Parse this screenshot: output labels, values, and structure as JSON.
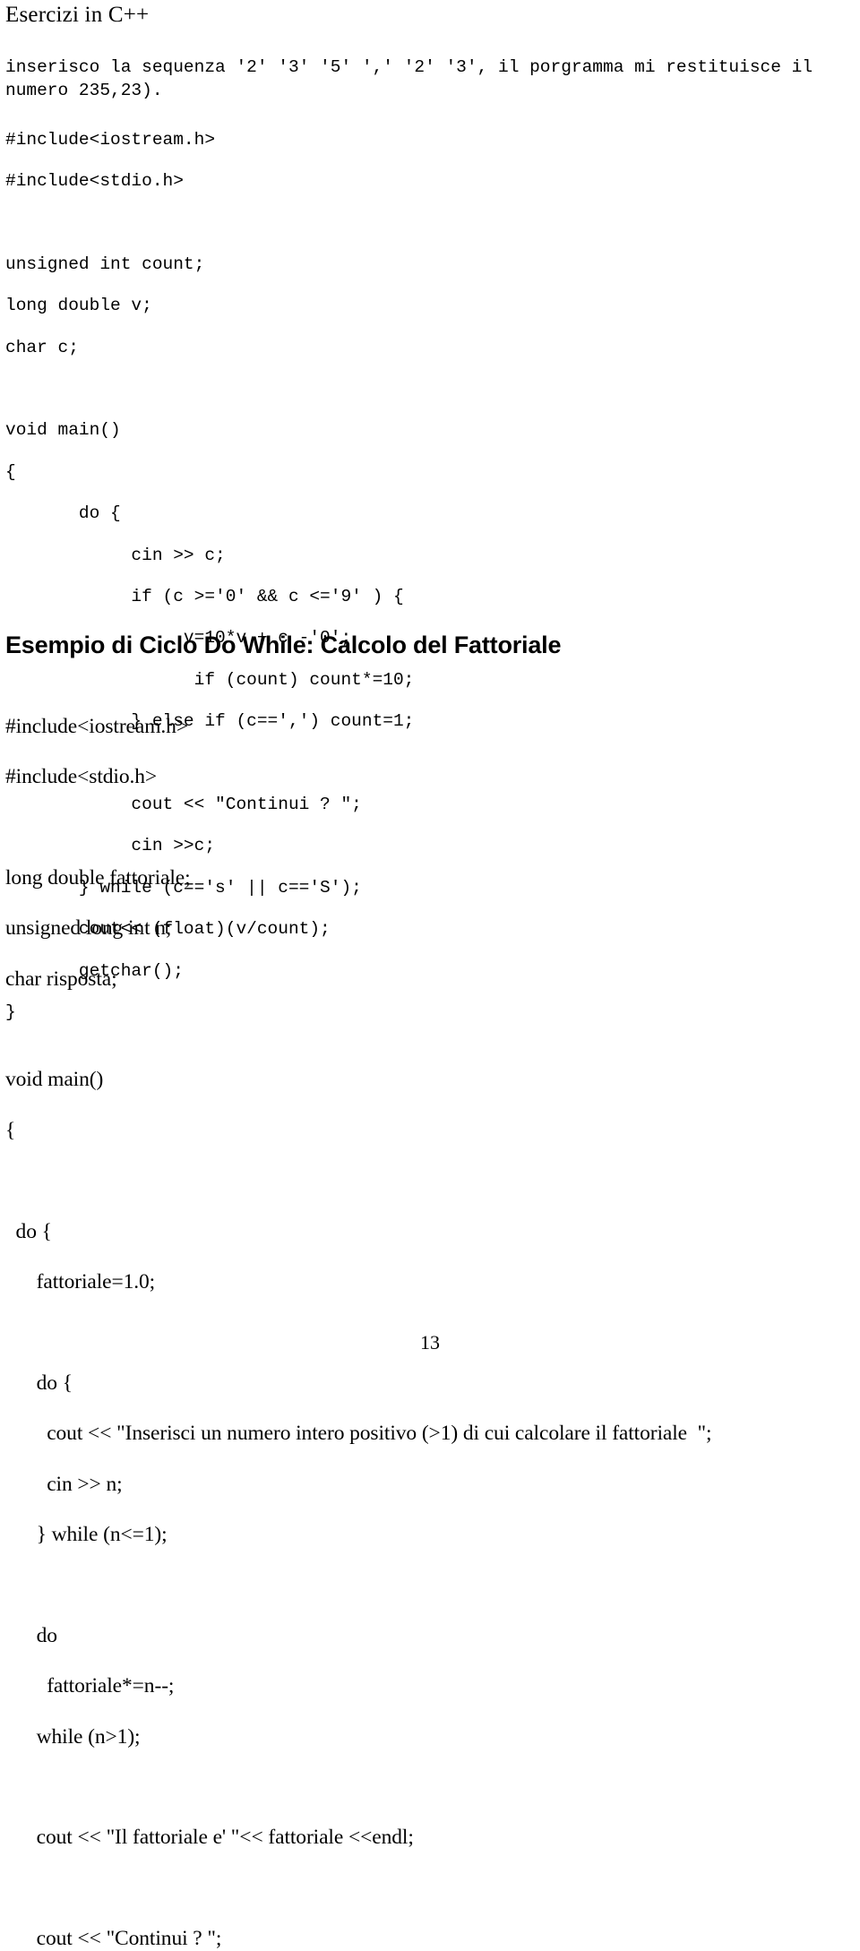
{
  "document": {
    "header_title": "Esercizi in C++",
    "page_number": "13",
    "background_color": "#ffffff",
    "text_color": "#000000"
  },
  "intro_paragraph": {
    "text": "inserisco la sequenza '2' '3' '5' ',' '2' '3', il porgramma mi restituisce il\nnumero 235,23)."
  },
  "code_block_1": {
    "font": "monospace",
    "lines": [
      "#include<iostream.h>",
      "#include<stdio.h>",
      "",
      "unsigned int count;",
      "long double v;",
      "char c;",
      "",
      "void main()",
      "{",
      "       do {",
      "            cin >> c;",
      "            if (c >='0' && c <='9' ) {",
      "                 v=10*v + c -'0';",
      "                  if (count) count*=10;",
      "            } else if (c==',') count=1;",
      "",
      "            cout << \"Continui ? \";",
      "            cin >>c;",
      "       } while (c=='s' || c=='S');",
      "       cout<< (float)(v/count);",
      "       getchar();",
      "}"
    ]
  },
  "section_heading": {
    "text": "Esempio di Ciclo Do While: Calcolo del Fattoriale"
  },
  "code_block_2": {
    "font": "serif",
    "lines": [
      "#include<iostream.h>",
      "#include<stdio.h>",
      "",
      "long double fattoriale;",
      "unsigned long int n;",
      "char risposta;",
      "",
      "void main()",
      "{",
      "",
      "  do {",
      "      fattoriale=1.0;",
      "",
      "      do {",
      "        cout << \"Inserisci un numero intero positivo (>1) di cui calcolare il fattoriale  \";",
      "        cin >> n;",
      "      } while (n<=1);",
      "",
      "      do",
      "        fattoriale*=n--;",
      "      while (n>1);",
      "",
      "      cout << \"Il fattoriale e' \"<< fattoriale <<endl;",
      "",
      "      cout << \"Continui ? \";"
    ]
  }
}
